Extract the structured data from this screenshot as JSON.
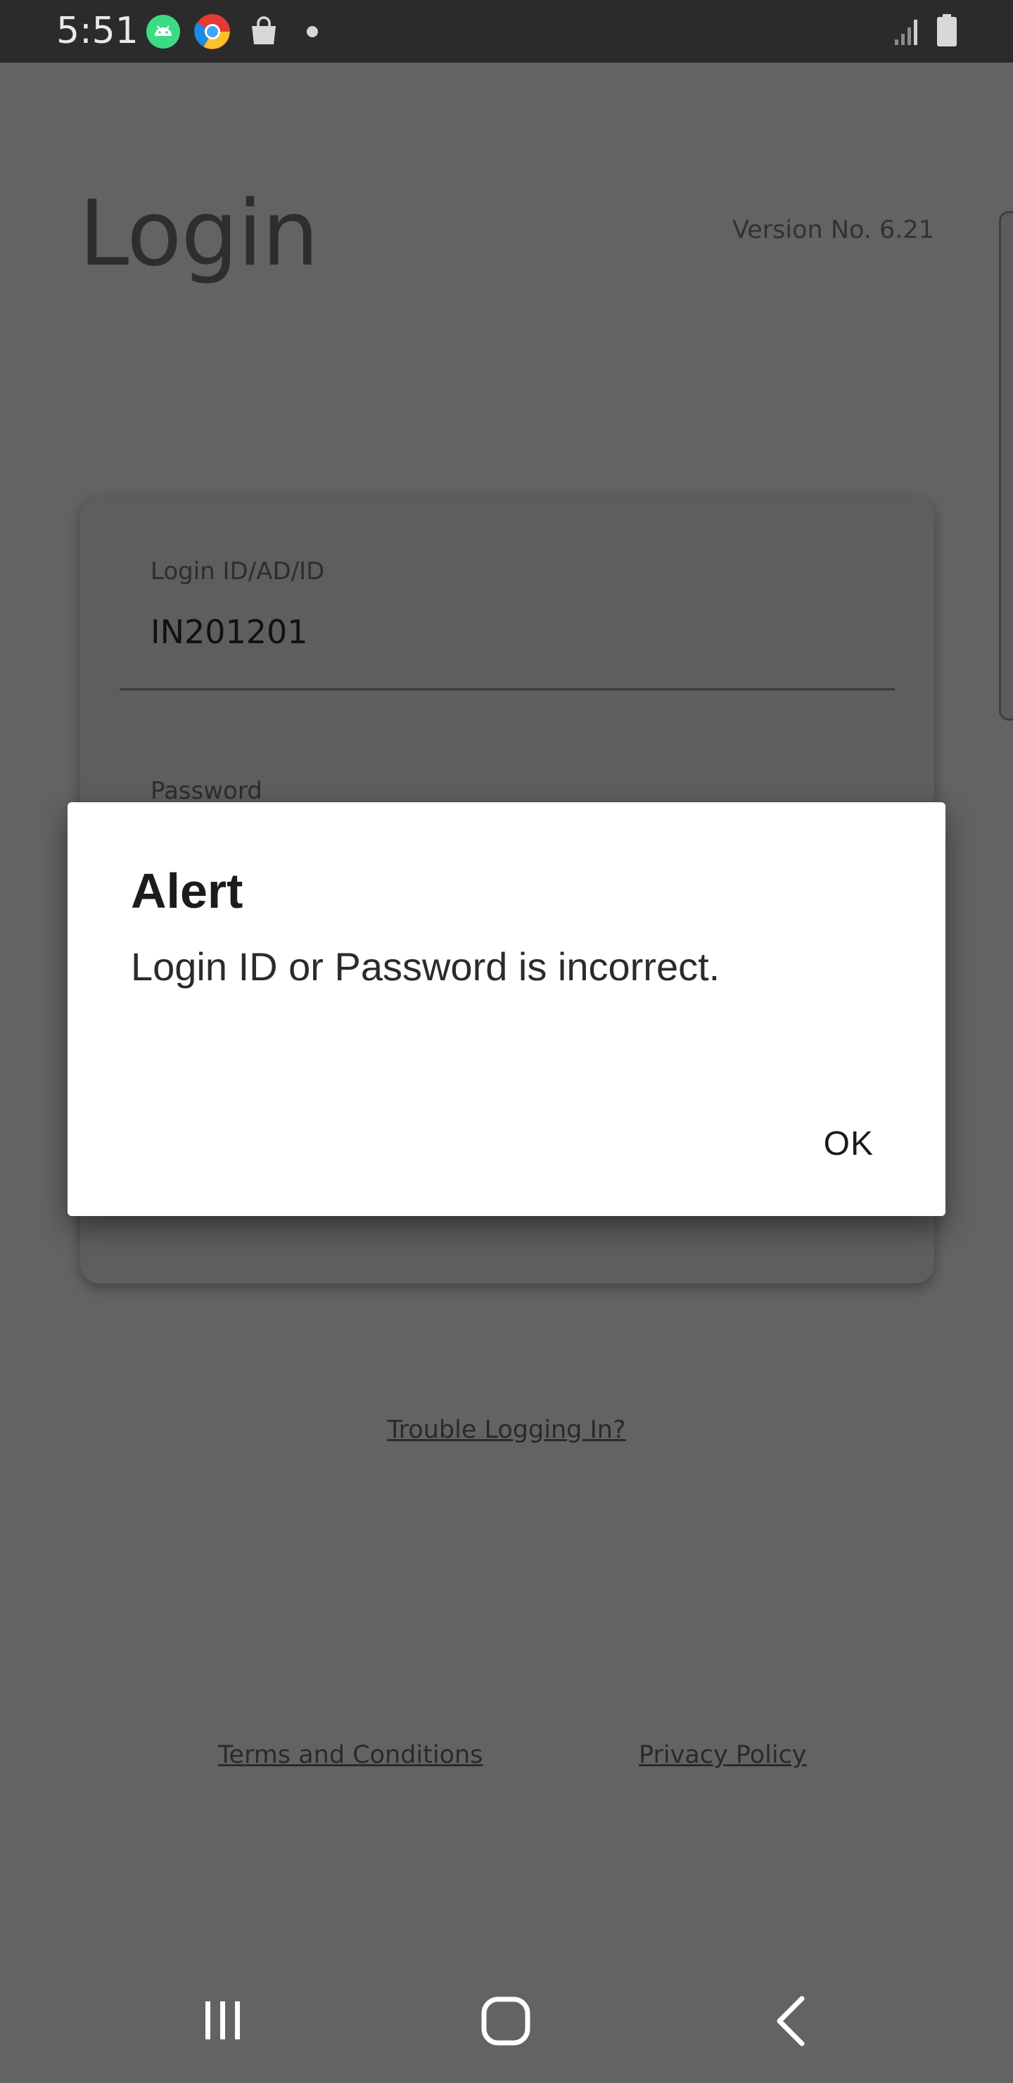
{
  "status_bar": {
    "time": "5:51"
  },
  "page": {
    "title": "Login",
    "version": "Version No. 6.21"
  },
  "login_form": {
    "login_id": {
      "label": "Login ID/AD/ID",
      "value": "IN201201"
    },
    "password": {
      "label": "Password"
    }
  },
  "links": {
    "trouble": "Trouble Logging In?",
    "terms": "Terms and Conditions",
    "privacy": "Privacy Policy"
  },
  "alert": {
    "title": "Alert",
    "message": "Login ID or Password is incorrect.",
    "ok_label": "OK"
  },
  "icons": {
    "status": [
      "android-icon",
      "chrome-icon",
      "shopping-bag-icon",
      "notification-dot-icon",
      "signal-icon",
      "battery-icon"
    ],
    "nav": [
      "recents-icon",
      "home-icon",
      "back-icon"
    ]
  },
  "colors": {
    "scrim_background": "#636363",
    "status_bar": "#2b2b2b",
    "dialog_background": "#ffffff",
    "android_badge": "#3ddc84"
  }
}
